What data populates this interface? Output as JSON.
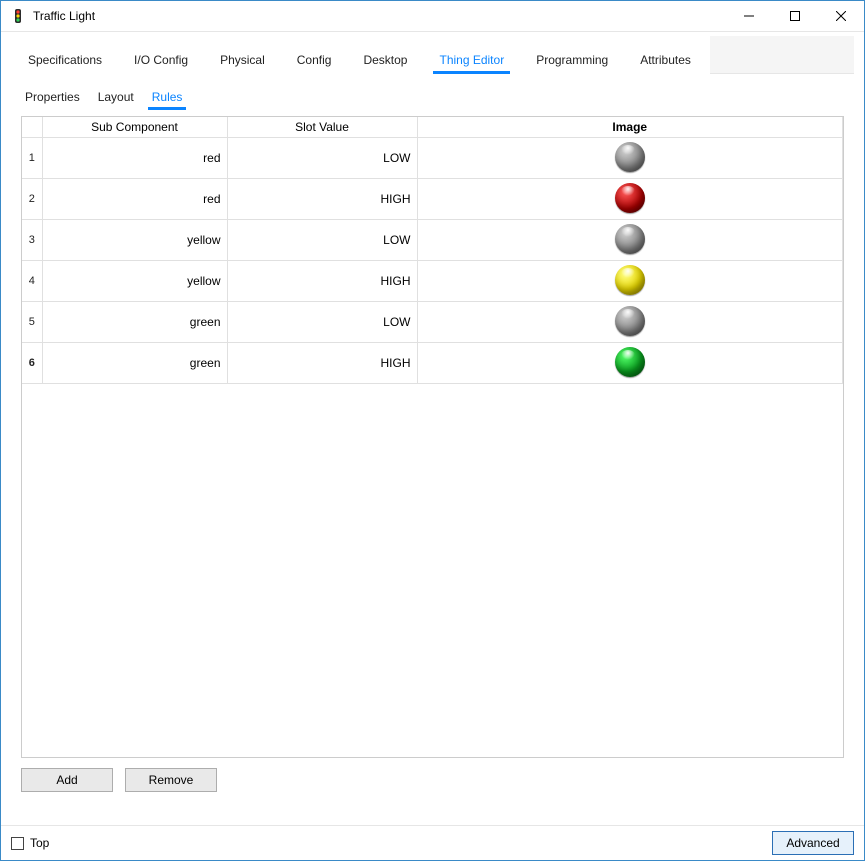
{
  "window": {
    "title": "Traffic Light"
  },
  "tabs": {
    "items": [
      {
        "label": "Specifications"
      },
      {
        "label": "I/O Config"
      },
      {
        "label": "Physical"
      },
      {
        "label": "Config"
      },
      {
        "label": "Desktop"
      },
      {
        "label": "Thing Editor"
      },
      {
        "label": "Programming"
      },
      {
        "label": "Attributes"
      }
    ],
    "active_index": 5
  },
  "subtabs": {
    "items": [
      {
        "label": "Properties"
      },
      {
        "label": "Layout"
      },
      {
        "label": "Rules"
      }
    ],
    "active_index": 2
  },
  "table": {
    "headers": {
      "sub_component": "Sub Component",
      "slot_value": "Slot Value",
      "image": "Image"
    },
    "rows": [
      {
        "num": "1",
        "sub": "red",
        "slot": "LOW",
        "image": "off"
      },
      {
        "num": "2",
        "sub": "red",
        "slot": "HIGH",
        "image": "red-on"
      },
      {
        "num": "3",
        "sub": "yellow",
        "slot": "LOW",
        "image": "off"
      },
      {
        "num": "4",
        "sub": "yellow",
        "slot": "HIGH",
        "image": "yellow-on"
      },
      {
        "num": "5",
        "sub": "green",
        "slot": "LOW",
        "image": "off"
      },
      {
        "num": "6",
        "sub": "green",
        "slot": "HIGH",
        "image": "green-on"
      }
    ],
    "selected_row": 5
  },
  "buttons": {
    "add": "Add",
    "remove": "Remove",
    "advanced": "Advanced"
  },
  "footer": {
    "top_label": "Top",
    "top_checked": false
  },
  "icons": {
    "minimize": "minimize-icon",
    "maximize": "maximize-icon",
    "close": "close-icon",
    "app": "traffic-light-app-icon"
  }
}
